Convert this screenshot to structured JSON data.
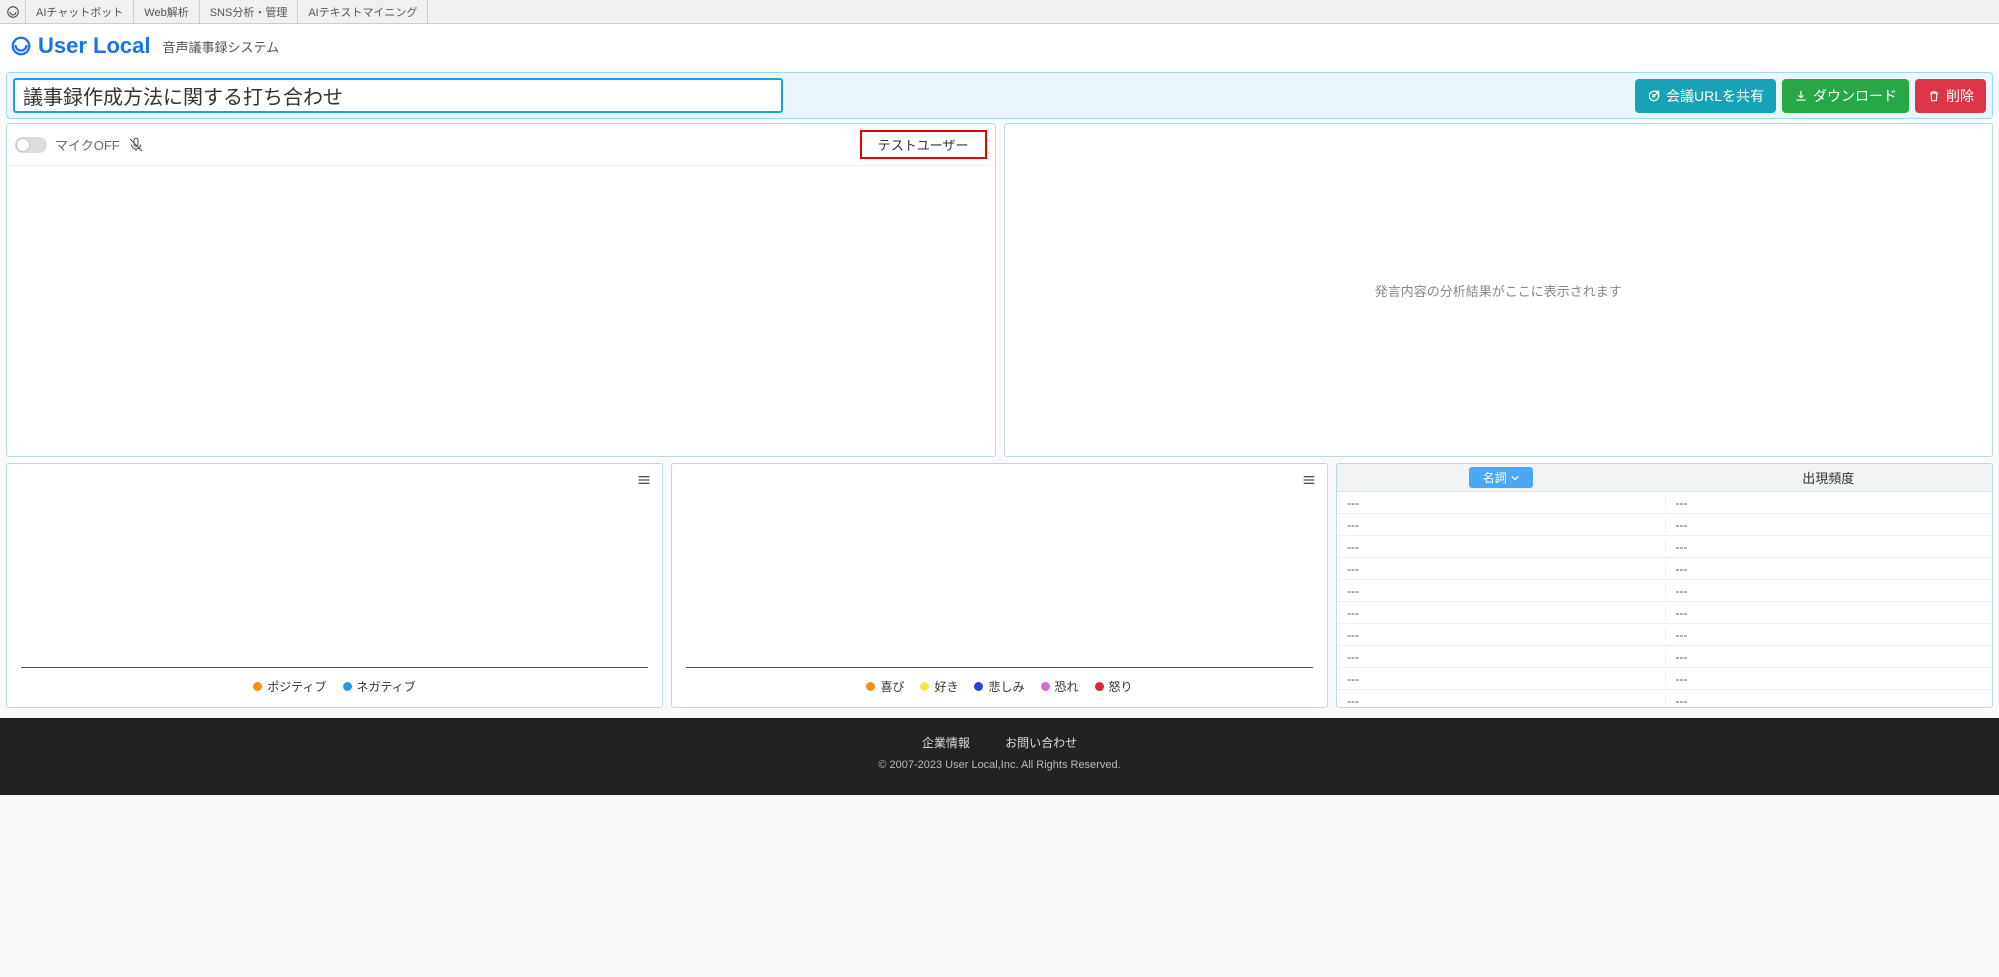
{
  "topnav": {
    "items": [
      "AIチャットボット",
      "Web解析",
      "SNS分析・管理",
      "AIテキストマイニング"
    ]
  },
  "brand": {
    "name": "User Local",
    "subtitle": "音声議事録システム"
  },
  "toolbar": {
    "title_value": "議事録作成方法に関する打ち合わせ",
    "share_label": "会議URLを共有",
    "download_label": "ダウンロード",
    "delete_label": "削除"
  },
  "transcript": {
    "mic_label": "マイクOFF",
    "user_display": "テストユーザー"
  },
  "analysis": {
    "placeholder": "発言内容の分析結果がここに表示されます"
  },
  "chart1": {
    "legend": [
      {
        "label": "ポジティブ",
        "color": "#f58c1f"
      },
      {
        "label": "ネガティブ",
        "color": "#1f9dd8"
      }
    ]
  },
  "chart2": {
    "legend": [
      {
        "label": "喜び",
        "color": "#f58c1f"
      },
      {
        "label": "好き",
        "color": "#f5e84a"
      },
      {
        "label": "悲しみ",
        "color": "#2e3fd8"
      },
      {
        "label": "恐れ",
        "color": "#d86ad0"
      },
      {
        "label": "怒り",
        "color": "#d8263f"
      }
    ]
  },
  "freq": {
    "header_noun": "名詞",
    "header_count": "出現頻度",
    "rows": [
      {
        "term": "---",
        "count": "---"
      },
      {
        "term": "---",
        "count": "---"
      },
      {
        "term": "---",
        "count": "---"
      },
      {
        "term": "---",
        "count": "---"
      },
      {
        "term": "---",
        "count": "---"
      },
      {
        "term": "---",
        "count": "---"
      },
      {
        "term": "---",
        "count": "---"
      },
      {
        "term": "---",
        "count": "---"
      },
      {
        "term": "---",
        "count": "---"
      },
      {
        "term": "---",
        "count": "---"
      }
    ]
  },
  "footer": {
    "link1": "企業情報",
    "link2": "お問い合わせ",
    "copyright": "© 2007-2023 User Local,Inc. All Rights Reserved."
  },
  "chart_data": [
    {
      "type": "line",
      "title": "",
      "series": [
        {
          "name": "ポジティブ",
          "values": []
        },
        {
          "name": "ネガティブ",
          "values": []
        }
      ],
      "x": []
    },
    {
      "type": "line",
      "title": "",
      "series": [
        {
          "name": "喜び",
          "values": []
        },
        {
          "name": "好き",
          "values": []
        },
        {
          "name": "悲しみ",
          "values": []
        },
        {
          "name": "恐れ",
          "values": []
        },
        {
          "name": "怒り",
          "values": []
        }
      ],
      "x": []
    }
  ]
}
